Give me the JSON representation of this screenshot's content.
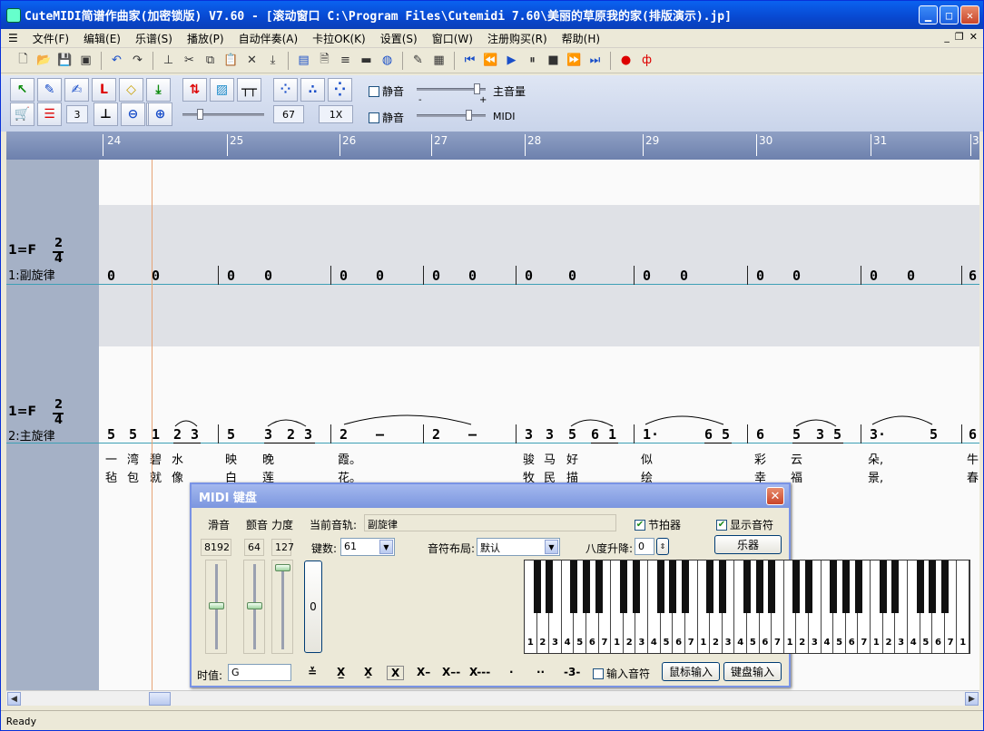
{
  "window": {
    "title": "CuteMIDI简谱作曲家(加密锁版) V7.60 - [滚动窗口  C:\\Program Files\\Cutemidi 7.60\\美丽的草原我的家(排版演示).jp]"
  },
  "menu": [
    "文件(F)",
    "编辑(E)",
    "乐谱(S)",
    "播放(P)",
    "自动伴奏(A)",
    "卡拉OK(K)",
    "设置(S)",
    "窗口(W)",
    "注册购买(R)",
    "帮助(H)"
  ],
  "palette": {
    "beats_value": "3",
    "tempo_value": "67",
    "speed_value": "1X",
    "mute1_label": "静音",
    "mute2_label": "静音",
    "master_volume_label": "主音量",
    "midi_label": "MIDI",
    "minus": "-",
    "plus": "+"
  },
  "ruler": {
    "measures": [
      "24",
      "25",
      "26",
      "27",
      "28",
      "29",
      "30",
      "31",
      "3"
    ]
  },
  "tracks": [
    {
      "key": "1=F",
      "time_top": "2",
      "time_bottom": "4",
      "name": "1:副旋律"
    },
    {
      "key": "1=F",
      "time_top": "2",
      "time_bottom": "4",
      "name": "2:主旋律"
    }
  ],
  "score": {
    "track1_notes": [
      "0",
      "0",
      "0",
      "0",
      "0",
      "0",
      "0",
      "0",
      "0",
      "0",
      "0",
      "0",
      "0",
      "0",
      "0",
      "0",
      "6"
    ],
    "track2_notes": [
      "5",
      "5",
      "1",
      "2",
      "3",
      "5",
      "3",
      "2",
      "3",
      "2",
      "–",
      "2",
      "–",
      "3",
      "3",
      "5",
      "6",
      "1",
      "1·",
      "6",
      "5",
      "6",
      "5",
      "3",
      "5",
      "3·",
      "5",
      "6"
    ],
    "lyrics1": [
      "一",
      "湾",
      "碧",
      "水",
      "映",
      "晚",
      "霞。",
      "骏",
      "马",
      "好",
      "似",
      "彩",
      "云",
      "朵,",
      "牛"
    ],
    "lyrics2": [
      "毡",
      "包",
      "就",
      "像",
      "白",
      "莲",
      "花。",
      "牧",
      "民",
      "描",
      "绘",
      "幸",
      "福",
      "景,",
      "春"
    ]
  },
  "status": {
    "text": "Ready"
  },
  "dialog": {
    "title": "MIDI 键盘",
    "pitch_label": "滑音",
    "vibrato_label": "颤音",
    "velocity_label": "力度",
    "pitch_value": "8192",
    "vibrato_value": "64",
    "velocity_value": "127",
    "current_track_label": "当前音轨:",
    "current_track_value": "副旋律",
    "metronome_label": "节拍器",
    "show_notes_label": "显示音符",
    "keys_label": "键数:",
    "keys_value": "61",
    "layout_label": "音符布局:",
    "layout_value": "默认",
    "octave_label": "八度升降:",
    "octave_value": "0",
    "instrument_button": "乐器",
    "center_value": "0",
    "duration_label": "时值:",
    "duration_value": "G",
    "input_notes_label": "输入音符",
    "mouse_input_button": "鼠标输入",
    "keyboard_input_button": "键盘输入",
    "key_labels": [
      "1",
      "2",
      "3",
      "4",
      "5",
      "6",
      "7",
      "1",
      "2",
      "3",
      "4",
      "5",
      "6",
      "7",
      "1",
      "2",
      "3",
      "4",
      "5",
      "6",
      "7",
      "1",
      "2",
      "3",
      "4",
      "5",
      "6",
      "7",
      "1",
      "2",
      "3",
      "4",
      "5",
      "6",
      "7",
      "1"
    ]
  }
}
